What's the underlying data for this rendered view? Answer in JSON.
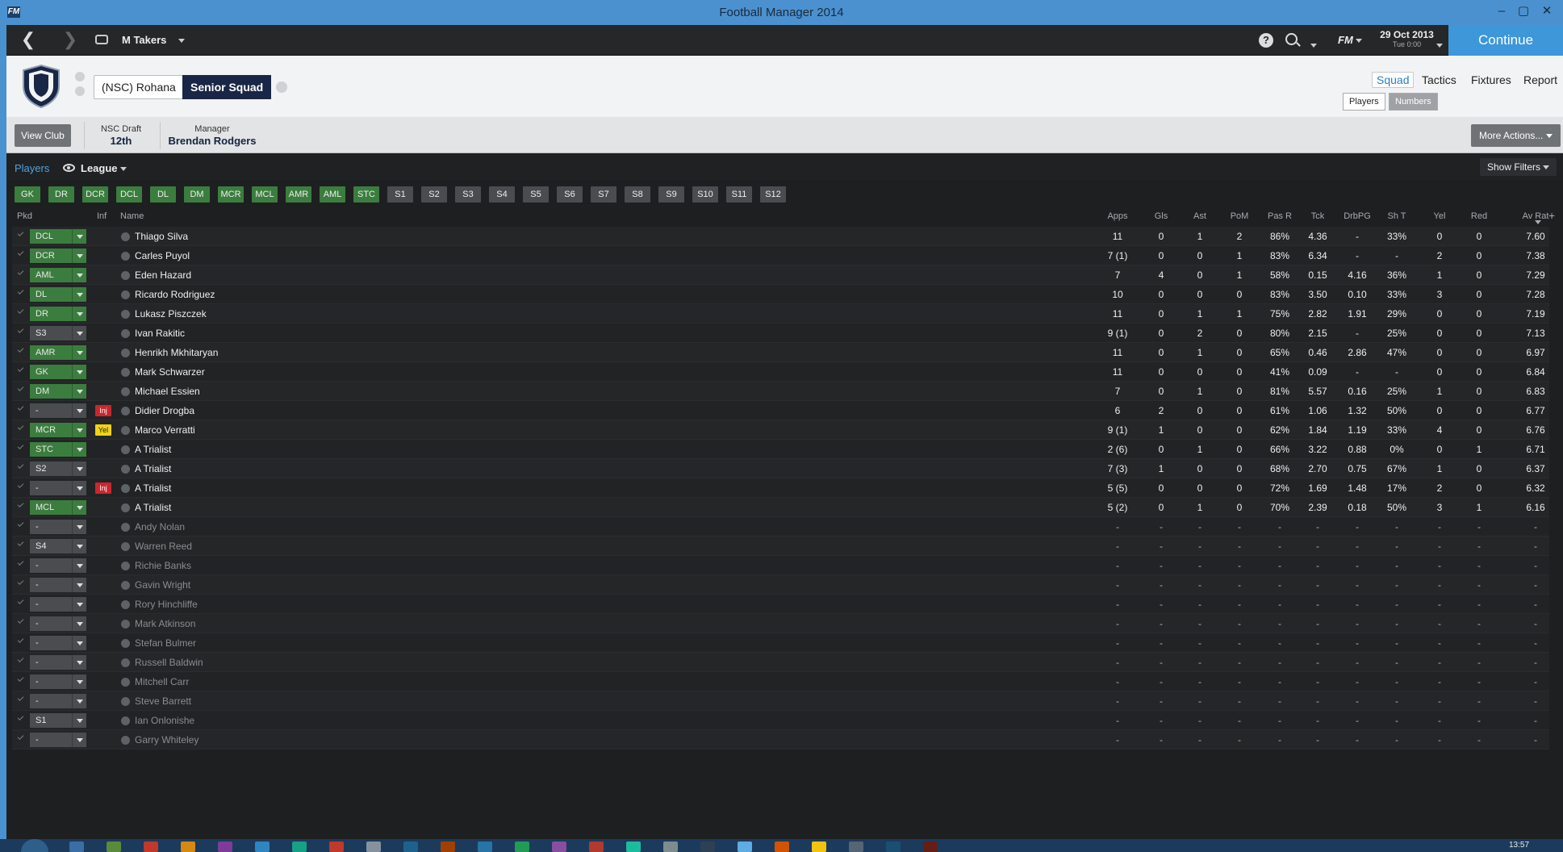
{
  "window": {
    "title": "Football Manager 2014",
    "app_icon": "FM"
  },
  "topnav": {
    "manager": "M Takers",
    "fm_label": "FM",
    "date": "29 Oct 2013",
    "date_sub": "Tue 0:00",
    "continue_label": "Continue"
  },
  "club": {
    "name_tab": "(NSC) Rohana",
    "squad_tab": "Senior Squad",
    "nav": [
      "Squad",
      "Tactics",
      "Fixtures",
      "Report"
    ],
    "seg": [
      "Players",
      "Numbers"
    ]
  },
  "info": {
    "view_club": "View Club",
    "draft_label": "NSC Draft",
    "draft_value": "12th",
    "manager_label": "Manager",
    "manager_value": "Brendan Rodgers",
    "more_actions": "More Actions..."
  },
  "players_bar": {
    "title": "Players",
    "scope": "League",
    "show_filters": "Show Filters"
  },
  "positions": [
    "GK",
    "DR",
    "DCR",
    "DCL",
    "DL",
    "DM",
    "MCR",
    "MCL",
    "AMR",
    "AML",
    "STC",
    "S1",
    "S2",
    "S3",
    "S4",
    "S5",
    "S6",
    "S7",
    "S8",
    "S9",
    "S10",
    "S11",
    "S12"
  ],
  "columns": [
    "Pkd",
    "Inf",
    "Name",
    "Apps",
    "Gls",
    "Ast",
    "PoM",
    "Pas R",
    "Tck",
    "DrbPG",
    "Sh T",
    "Yel",
    "Red",
    "Av Rat"
  ],
  "rows": [
    {
      "pkd": "DCL",
      "inf": "",
      "name": "Thiago Silva",
      "apps": "11",
      "gls": "0",
      "ast": "1",
      "pom": "2",
      "pas": "86%",
      "tck": "4.36",
      "drb": "-",
      "sht": "33%",
      "yel": "0",
      "red": "0",
      "rat": "7.60"
    },
    {
      "pkd": "DCR",
      "inf": "",
      "name": "Carles Puyol",
      "apps": "7 (1)",
      "gls": "0",
      "ast": "0",
      "pom": "1",
      "pas": "83%",
      "tck": "6.34",
      "drb": "-",
      "sht": "-",
      "yel": "2",
      "red": "0",
      "rat": "7.38"
    },
    {
      "pkd": "AML",
      "inf": "",
      "name": "Eden Hazard",
      "apps": "7",
      "gls": "4",
      "ast": "0",
      "pom": "1",
      "pas": "58%",
      "tck": "0.15",
      "drb": "4.16",
      "sht": "36%",
      "yel": "1",
      "red": "0",
      "rat": "7.29"
    },
    {
      "pkd": "DL",
      "inf": "",
      "name": "Ricardo Rodriguez",
      "apps": "10",
      "gls": "0",
      "ast": "0",
      "pom": "0",
      "pas": "83%",
      "tck": "3.50",
      "drb": "0.10",
      "sht": "33%",
      "yel": "3",
      "red": "0",
      "rat": "7.28"
    },
    {
      "pkd": "DR",
      "inf": "",
      "name": "Lukasz Piszczek",
      "apps": "11",
      "gls": "0",
      "ast": "1",
      "pom": "1",
      "pas": "75%",
      "tck": "2.82",
      "drb": "1.91",
      "sht": "29%",
      "yel": "0",
      "red": "0",
      "rat": "7.19"
    },
    {
      "pkd": "S3",
      "inf": "",
      "name": "Ivan Rakitic",
      "apps": "9 (1)",
      "gls": "0",
      "ast": "2",
      "pom": "0",
      "pas": "80%",
      "tck": "2.15",
      "drb": "-",
      "sht": "25%",
      "yel": "0",
      "red": "0",
      "rat": "7.13"
    },
    {
      "pkd": "AMR",
      "inf": "",
      "name": "Henrikh Mkhitaryan",
      "apps": "11",
      "gls": "0",
      "ast": "1",
      "pom": "0",
      "pas": "65%",
      "tck": "0.46",
      "drb": "2.86",
      "sht": "47%",
      "yel": "0",
      "red": "0",
      "rat": "6.97"
    },
    {
      "pkd": "GK",
      "inf": "",
      "name": "Mark Schwarzer",
      "apps": "11",
      "gls": "0",
      "ast": "0",
      "pom": "0",
      "pas": "41%",
      "tck": "0.09",
      "drb": "-",
      "sht": "-",
      "yel": "0",
      "red": "0",
      "rat": "6.84"
    },
    {
      "pkd": "DM",
      "inf": "",
      "name": "Michael Essien",
      "apps": "7",
      "gls": "0",
      "ast": "1",
      "pom": "0",
      "pas": "81%",
      "tck": "5.57",
      "drb": "0.16",
      "sht": "25%",
      "yel": "1",
      "red": "0",
      "rat": "6.83"
    },
    {
      "pkd": "-",
      "inf": "Inj",
      "name": "Didier Drogba",
      "apps": "6",
      "gls": "2",
      "ast": "0",
      "pom": "0",
      "pas": "61%",
      "tck": "1.06",
      "drb": "1.32",
      "sht": "50%",
      "yel": "0",
      "red": "0",
      "rat": "6.77"
    },
    {
      "pkd": "MCR",
      "inf": "Yel",
      "name": "Marco Verratti",
      "apps": "9 (1)",
      "gls": "1",
      "ast": "0",
      "pom": "0",
      "pas": "62%",
      "tck": "1.84",
      "drb": "1.19",
      "sht": "33%",
      "yel": "4",
      "red": "0",
      "rat": "6.76"
    },
    {
      "pkd": "STC",
      "inf": "",
      "name": "A Trialist",
      "apps": "2 (6)",
      "gls": "0",
      "ast": "1",
      "pom": "0",
      "pas": "66%",
      "tck": "3.22",
      "drb": "0.88",
      "sht": "0%",
      "yel": "0",
      "red": "1",
      "rat": "6.71"
    },
    {
      "pkd": "S2",
      "inf": "",
      "name": "A Trialist",
      "apps": "7 (3)",
      "gls": "1",
      "ast": "0",
      "pom": "0",
      "pas": "68%",
      "tck": "2.70",
      "drb": "0.75",
      "sht": "67%",
      "yel": "1",
      "red": "0",
      "rat": "6.37"
    },
    {
      "pkd": "-",
      "inf": "Inj",
      "name": "A Trialist",
      "apps": "5 (5)",
      "gls": "0",
      "ast": "0",
      "pom": "0",
      "pas": "72%",
      "tck": "1.69",
      "drb": "1.48",
      "sht": "17%",
      "yel": "2",
      "red": "0",
      "rat": "6.32"
    },
    {
      "pkd": "MCL",
      "inf": "",
      "name": "A Trialist",
      "apps": "5 (2)",
      "gls": "0",
      "ast": "1",
      "pom": "0",
      "pas": "70%",
      "tck": "2.39",
      "drb": "0.18",
      "sht": "50%",
      "yel": "3",
      "red": "1",
      "rat": "6.16"
    },
    {
      "pkd": "-",
      "inf": "",
      "name": "Andy Nolan",
      "apps": "-",
      "gls": "-",
      "ast": "-",
      "pom": "-",
      "pas": "-",
      "tck": "-",
      "drb": "-",
      "sht": "-",
      "yel": "-",
      "red": "-",
      "rat": "-"
    },
    {
      "pkd": "S4",
      "inf": "",
      "name": "Warren Reed",
      "apps": "-",
      "gls": "-",
      "ast": "-",
      "pom": "-",
      "pas": "-",
      "tck": "-",
      "drb": "-",
      "sht": "-",
      "yel": "-",
      "red": "-",
      "rat": "-"
    },
    {
      "pkd": "-",
      "inf": "",
      "name": "Richie Banks",
      "apps": "-",
      "gls": "-",
      "ast": "-",
      "pom": "-",
      "pas": "-",
      "tck": "-",
      "drb": "-",
      "sht": "-",
      "yel": "-",
      "red": "-",
      "rat": "-"
    },
    {
      "pkd": "-",
      "inf": "",
      "name": "Gavin Wright",
      "apps": "-",
      "gls": "-",
      "ast": "-",
      "pom": "-",
      "pas": "-",
      "tck": "-",
      "drb": "-",
      "sht": "-",
      "yel": "-",
      "red": "-",
      "rat": "-"
    },
    {
      "pkd": "-",
      "inf": "",
      "name": "Rory Hinchliffe",
      "apps": "-",
      "gls": "-",
      "ast": "-",
      "pom": "-",
      "pas": "-",
      "tck": "-",
      "drb": "-",
      "sht": "-",
      "yel": "-",
      "red": "-",
      "rat": "-"
    },
    {
      "pkd": "-",
      "inf": "",
      "name": "Mark Atkinson",
      "apps": "-",
      "gls": "-",
      "ast": "-",
      "pom": "-",
      "pas": "-",
      "tck": "-",
      "drb": "-",
      "sht": "-",
      "yel": "-",
      "red": "-",
      "rat": "-"
    },
    {
      "pkd": "-",
      "inf": "",
      "name": "Stefan Bulmer",
      "apps": "-",
      "gls": "-",
      "ast": "-",
      "pom": "-",
      "pas": "-",
      "tck": "-",
      "drb": "-",
      "sht": "-",
      "yel": "-",
      "red": "-",
      "rat": "-"
    },
    {
      "pkd": "-",
      "inf": "",
      "name": "Russell Baldwin",
      "apps": "-",
      "gls": "-",
      "ast": "-",
      "pom": "-",
      "pas": "-",
      "tck": "-",
      "drb": "-",
      "sht": "-",
      "yel": "-",
      "red": "-",
      "rat": "-"
    },
    {
      "pkd": "-",
      "inf": "",
      "name": "Mitchell Carr",
      "apps": "-",
      "gls": "-",
      "ast": "-",
      "pom": "-",
      "pas": "-",
      "tck": "-",
      "drb": "-",
      "sht": "-",
      "yel": "-",
      "red": "-",
      "rat": "-"
    },
    {
      "pkd": "-",
      "inf": "",
      "name": "Steve Barrett",
      "apps": "-",
      "gls": "-",
      "ast": "-",
      "pom": "-",
      "pas": "-",
      "tck": "-",
      "drb": "-",
      "sht": "-",
      "yel": "-",
      "red": "-",
      "rat": "-"
    },
    {
      "pkd": "S1",
      "inf": "",
      "name": "Ian Onlonishe",
      "apps": "-",
      "gls": "-",
      "ast": "-",
      "pom": "-",
      "pas": "-",
      "tck": "-",
      "drb": "-",
      "sht": "-",
      "yel": "-",
      "red": "-",
      "rat": "-"
    },
    {
      "pkd": "-",
      "inf": "",
      "name": "Garry Whiteley",
      "apps": "-",
      "gls": "-",
      "ast": "-",
      "pom": "-",
      "pas": "-",
      "tck": "-",
      "drb": "-",
      "sht": "-",
      "yel": "-",
      "red": "-",
      "rat": "-"
    }
  ],
  "taskbar": {
    "clock": "13:57"
  },
  "colors": {
    "accent": "#3d97d9",
    "position_green": "#3b7d3e",
    "injury": "#c9272d",
    "yellow": "#f0d314"
  }
}
